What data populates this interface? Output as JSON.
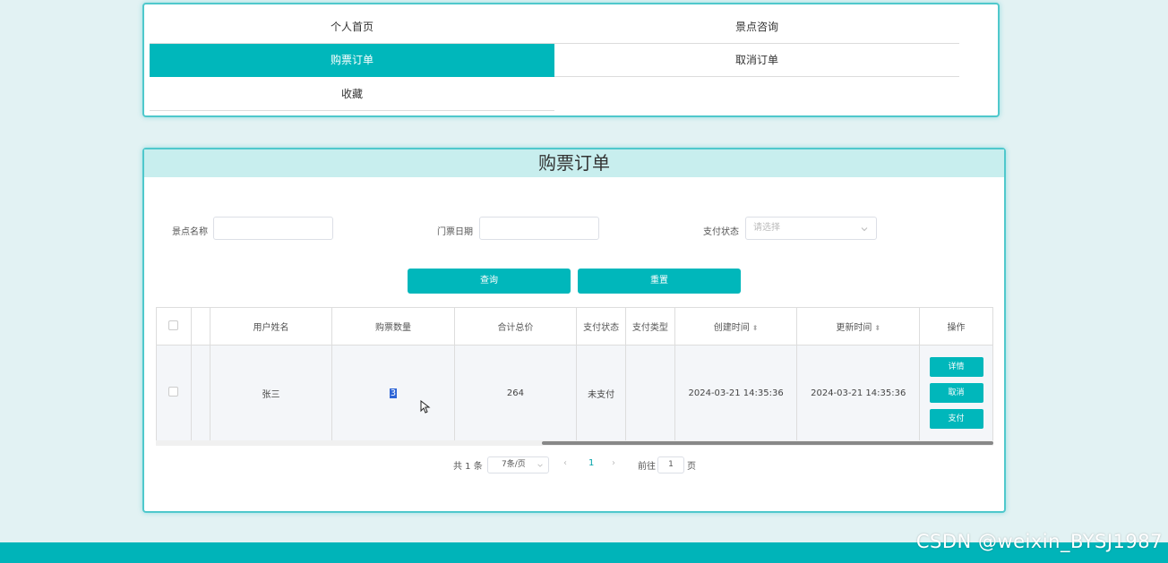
{
  "nav": {
    "items": [
      {
        "label": "个人首页",
        "active": false
      },
      {
        "label": "景点咨询",
        "active": false
      },
      {
        "label": "购票订单",
        "active": true
      },
      {
        "label": "取消订单",
        "active": false
      },
      {
        "label": "收藏",
        "active": false
      }
    ]
  },
  "page_title": "购票订单",
  "filters": {
    "spot_name_label": "景点名称",
    "spot_name_value": "",
    "ticket_date_label": "门票日期",
    "ticket_date_value": "",
    "pay_status_label": "支付状态",
    "pay_status_placeholder": "请选择"
  },
  "buttons": {
    "search": "查询",
    "reset": "重置"
  },
  "table": {
    "headers": [
      "用户姓名",
      "购票数量",
      "合计总价",
      "支付状态",
      "支付类型",
      "创建时间",
      "更新时间",
      "操作"
    ],
    "rows": [
      {
        "user_name": "张三",
        "quantity": "3",
        "total": "264",
        "pay_status": "未支付",
        "pay_type": "",
        "created": "2024-03-21 14:35:36",
        "updated": "2024-03-21 14:35:36",
        "actions": [
          "详情",
          "取消",
          "支付"
        ]
      }
    ]
  },
  "pagination": {
    "total_text": "共 1 条",
    "page_size": "7条/页",
    "current_page": "1",
    "goto_label": "前往",
    "goto_value": "1",
    "page_suffix": "页"
  },
  "watermark": "CSDN @weixin_BYSJ1987",
  "colors": {
    "accent": "#00b7bb",
    "background": "#e2f2f3",
    "title_bar": "#c8eeee"
  }
}
